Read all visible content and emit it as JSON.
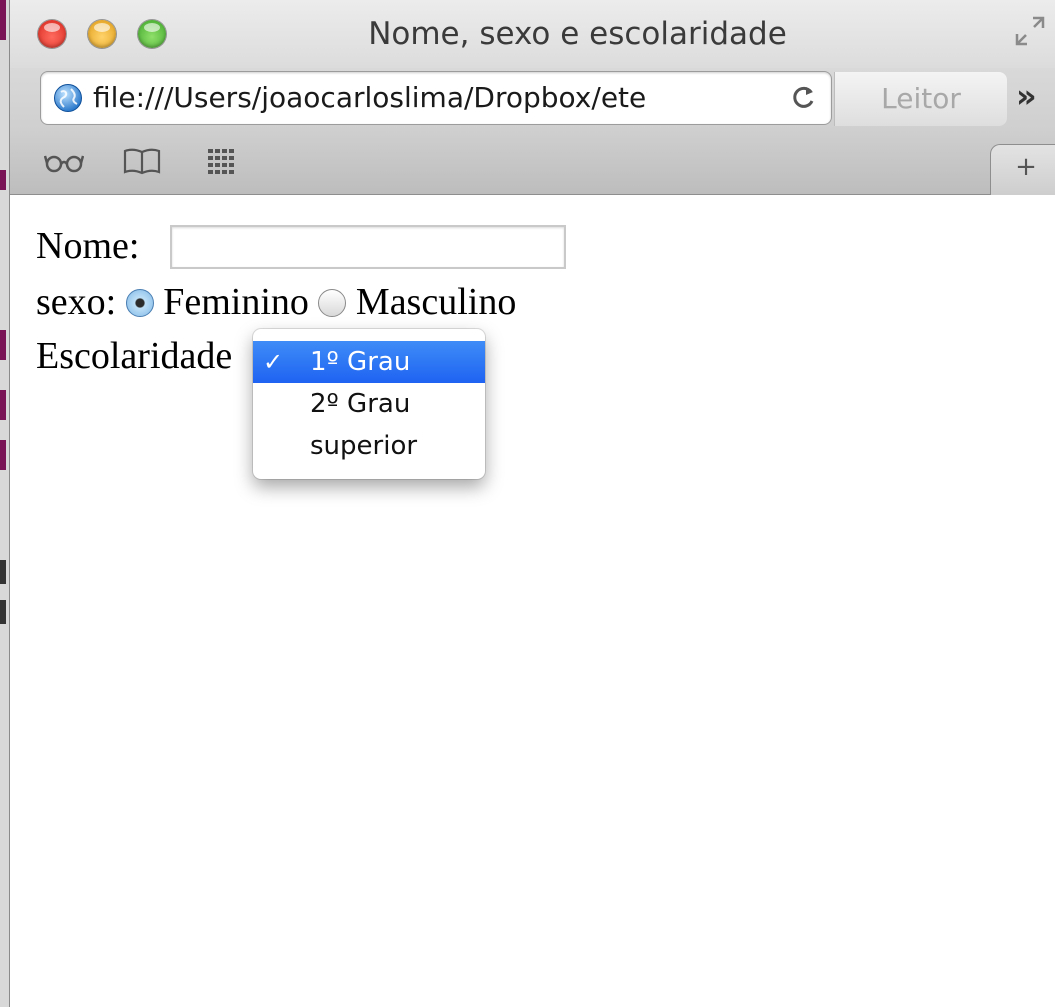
{
  "window": {
    "title": "Nome, sexo e escolaridade"
  },
  "toolbar": {
    "url": "file:///Users/joaocarloslima/Dropbox/ete",
    "reader_label": "Leitor",
    "more_label": "»"
  },
  "bookmarks": {
    "new_tab_label": "+"
  },
  "form": {
    "name_label": "Nome:",
    "name_value": "",
    "sex_label": "sexo:",
    "sex_options": [
      "Feminino",
      "Masculino"
    ],
    "sex_selected": "Feminino",
    "schooling_label": "Escolaridade",
    "schooling_options": [
      "1º Grau",
      "2º Grau",
      "superior"
    ],
    "schooling_selected": "1º Grau",
    "check_mark": "✓"
  },
  "colors": {
    "selection": "#2f72f4"
  }
}
